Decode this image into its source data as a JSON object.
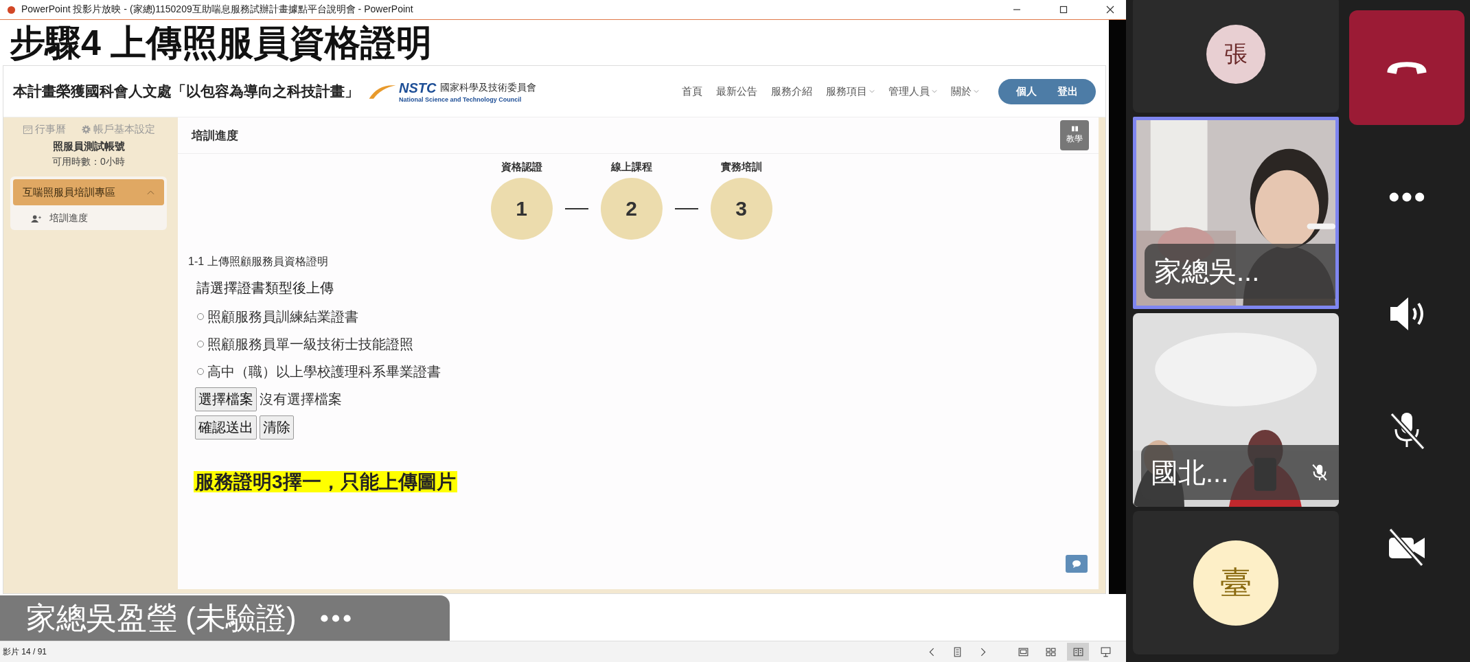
{
  "window": {
    "title": "PowerPoint 投影片放映 - (家總)1150209互助喘息服務試辦計畫據點平台說明會 - PowerPoint"
  },
  "slide": {
    "title": "步驟4 上傳照服員資格證明",
    "site": {
      "banner": "本計畫榮獲國科會人文處「以包容為導向之科技計畫」",
      "logo_mark": "NSTC",
      "logo_name": "國家科學及技術委員會",
      "logo_sub": "National Science and Technology Council",
      "nav": [
        {
          "label": "首頁",
          "dropdown": false
        },
        {
          "label": "最新公告",
          "dropdown": false
        },
        {
          "label": "服務介紹",
          "dropdown": false
        },
        {
          "label": "服務項目",
          "dropdown": true
        },
        {
          "label": "管理人員",
          "dropdown": true
        },
        {
          "label": "關於",
          "dropdown": true
        }
      ],
      "account_buttons": [
        "個人",
        "登出"
      ],
      "sidebar": {
        "links": [
          {
            "kind": "calendar",
            "label": "行事曆"
          },
          {
            "kind": "settings",
            "label": "帳戶基本設定"
          }
        ],
        "account_name": "照服員測試帳號",
        "hours": "可用時數：0小時",
        "section": {
          "label": "互喘照服員培訓專區",
          "expanded": true,
          "items": [
            {
              "label": "培訓進度"
            }
          ]
        }
      },
      "page_title": "培訓進度",
      "help_button": "教學",
      "steps": [
        {
          "label": "資格認證",
          "number": "1"
        },
        {
          "label": "線上課程",
          "number": "2"
        },
        {
          "label": "實務培訓",
          "number": "3"
        }
      ],
      "section_title": "1-1 上傳照顧服務員資格證明",
      "prompt": "請選擇證書類型後上傳",
      "options": [
        {
          "label": "照顧服務員訓練結業證書",
          "selected": false
        },
        {
          "label": "照顧服務員單一級技術士技能證照",
          "selected": false
        },
        {
          "label": "高中（職）以上學校護理科系畢業證書",
          "selected": false
        }
      ],
      "file_button": "選擇檔案",
      "file_status": "沒有選擇檔案",
      "buttons": [
        "確認送出",
        "清除"
      ],
      "note": "服務證明3擇一，只能上傳圖片"
    }
  },
  "status_bar": {
    "slide_counter": "影片 14 / 91",
    "views": [
      {
        "kind": "normal",
        "selected": false
      },
      {
        "kind": "sorter",
        "selected": false
      },
      {
        "kind": "reading",
        "selected": true
      },
      {
        "kind": "slideshow",
        "selected": false
      }
    ]
  },
  "speaker_overlay": {
    "name": "家總吳盈瑩 (未驗證)"
  },
  "call": {
    "participants": [
      {
        "kind": "avatar",
        "initial": "張",
        "color": "#e8cfd2",
        "speaking": false,
        "muted": false
      },
      {
        "kind": "video",
        "name": "家總吳...",
        "speaking": true,
        "muted": false
      },
      {
        "kind": "video",
        "name": "國北...",
        "speaking": false,
        "muted": true
      },
      {
        "kind": "avatar",
        "initial": "臺",
        "color": "#fdefc7",
        "speaking": false,
        "muted": false
      }
    ],
    "controls": {
      "speaker_on": true,
      "mic_muted": true,
      "camera_off": true
    }
  }
}
